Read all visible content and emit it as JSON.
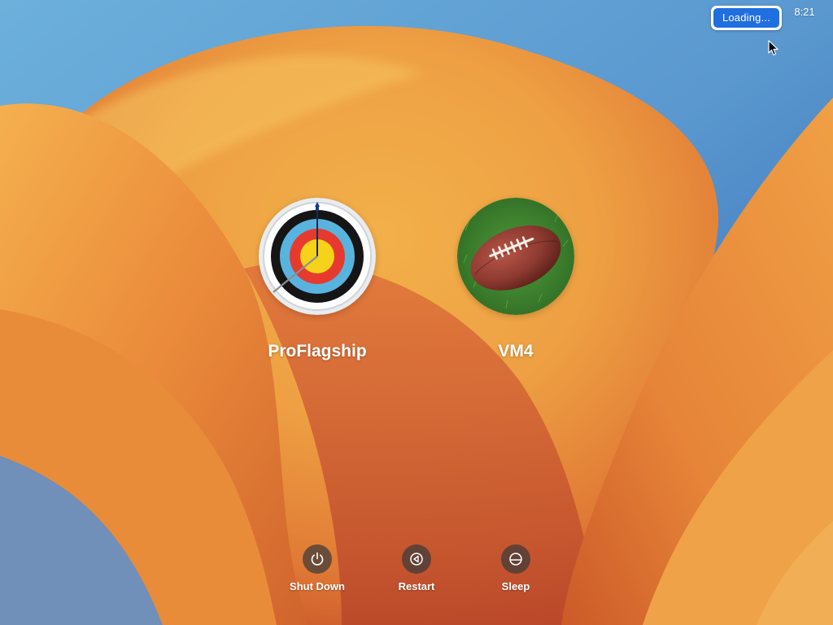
{
  "status": {
    "loading_label": "Loading...",
    "clock": "8:21"
  },
  "users": [
    {
      "name": "ProFlagship",
      "avatar_icon": "archery-target-icon"
    },
    {
      "name": "VM4",
      "avatar_icon": "football-icon"
    }
  ],
  "power_actions": [
    {
      "label": "Shut Down",
      "icon": "power-icon"
    },
    {
      "label": "Restart",
      "icon": "restart-icon"
    },
    {
      "label": "Sleep",
      "icon": "sleep-icon"
    }
  ],
  "colors": {
    "accent": "#1f6fe0",
    "wallpaper_blue": "#4a88c8",
    "wallpaper_orange": "#f0a040",
    "wallpaper_red": "#d85a2a"
  }
}
